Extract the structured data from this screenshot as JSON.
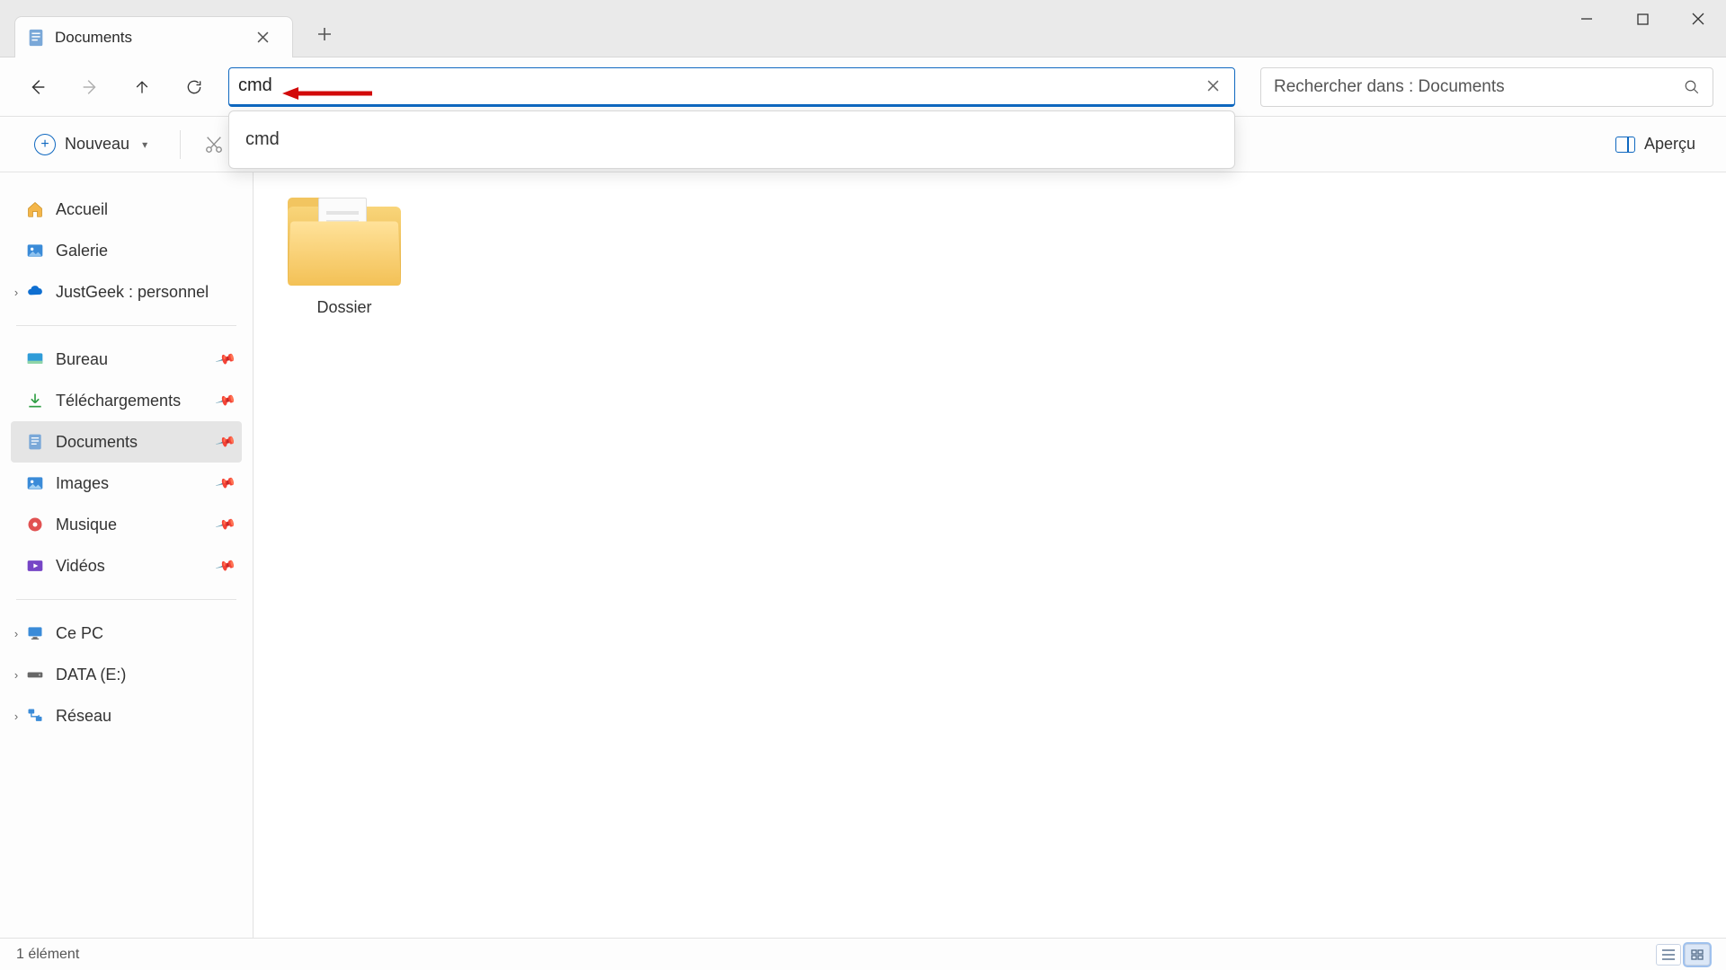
{
  "tab": {
    "title": "Documents"
  },
  "address_bar": {
    "value": "cmd",
    "suggestions": [
      "cmd"
    ]
  },
  "search": {
    "placeholder": "Rechercher dans : Documents"
  },
  "toolbar": {
    "new_label": "Nouveau",
    "preview_label": "Aperçu"
  },
  "sidebar": {
    "quick": [
      {
        "label": "Accueil"
      },
      {
        "label": "Galerie"
      },
      {
        "label": "JustGeek : personnel",
        "expandable": true
      }
    ],
    "pinned": [
      {
        "label": "Bureau"
      },
      {
        "label": "Téléchargements"
      },
      {
        "label": "Documents",
        "active": true
      },
      {
        "label": "Images"
      },
      {
        "label": "Musique"
      },
      {
        "label": "Vidéos"
      }
    ],
    "drives": [
      {
        "label": "Ce PC",
        "expandable": true
      },
      {
        "label": "DATA (E:)",
        "expandable": true
      },
      {
        "label": "Réseau",
        "expandable": true
      }
    ]
  },
  "content": {
    "items": [
      {
        "label": "Dossier"
      }
    ]
  },
  "status": {
    "count_text": "1 élément"
  }
}
